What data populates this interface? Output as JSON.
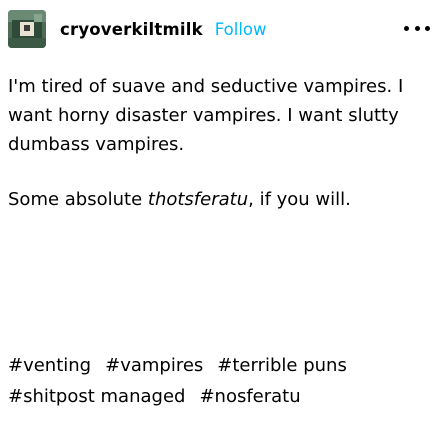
{
  "post": {
    "username": "cryoverkiltmilk",
    "follow_label": "Follow",
    "avatar_icon": "avatar-image",
    "more_icon": "more-options-icon",
    "body_paragraph_1": "I'm tired of suave and seductive vampires. I want horny disaster vampires. I want slutty dumbass vampires.",
    "body_paragraph_2_prefix": "Some absolute ",
    "body_paragraph_2_italic": "thotsferatu",
    "body_paragraph_2_suffix": ", if you will.",
    "tags": [
      "#venting",
      "#vampires",
      "#terrible puns",
      "#shitpost managed",
      "#nosferatu"
    ]
  },
  "colors": {
    "follow": "#00b8ff",
    "text": "#000000",
    "background": "#ffffff"
  }
}
